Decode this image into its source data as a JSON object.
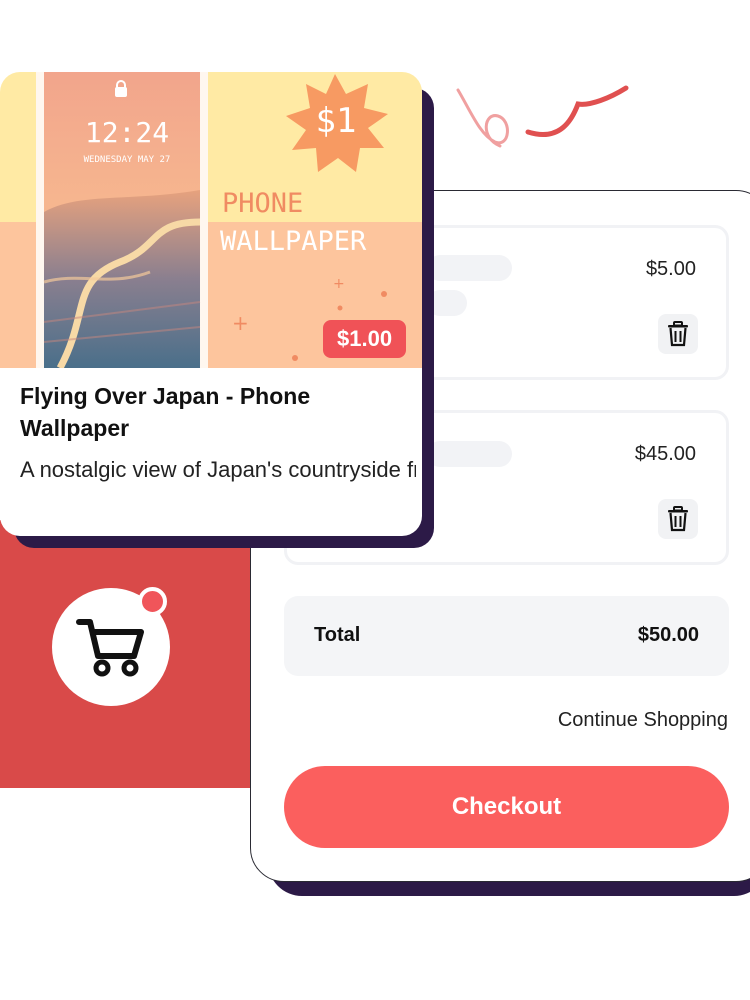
{
  "product": {
    "title": "Flying Over Japan - Phone Wallpaper",
    "description": "A nostalgic view of Japan's countryside from the window...",
    "price_badge": "$1.00",
    "image": {
      "time": "12:24",
      "date": "WEDNESDAY MAY 27",
      "burst_text": "$1",
      "caption_line1": "PHONE",
      "caption_line2": "WALLPAPER"
    }
  },
  "cart": {
    "items": [
      {
        "price": "$5.00"
      },
      {
        "price": "$45.00"
      }
    ],
    "total_label": "Total",
    "total_value": "$50.00",
    "continue_label": "Continue Shopping",
    "checkout_label": "Checkout"
  },
  "icons": {
    "cart": "shopping-cart-icon",
    "trash": "trash-icon",
    "lock": "lock-icon"
  },
  "colors": {
    "accent_red": "#fb5f5e",
    "panel_red": "#d94a49",
    "shadow_purple": "#2c1a47",
    "badge_red": "#f05257"
  }
}
